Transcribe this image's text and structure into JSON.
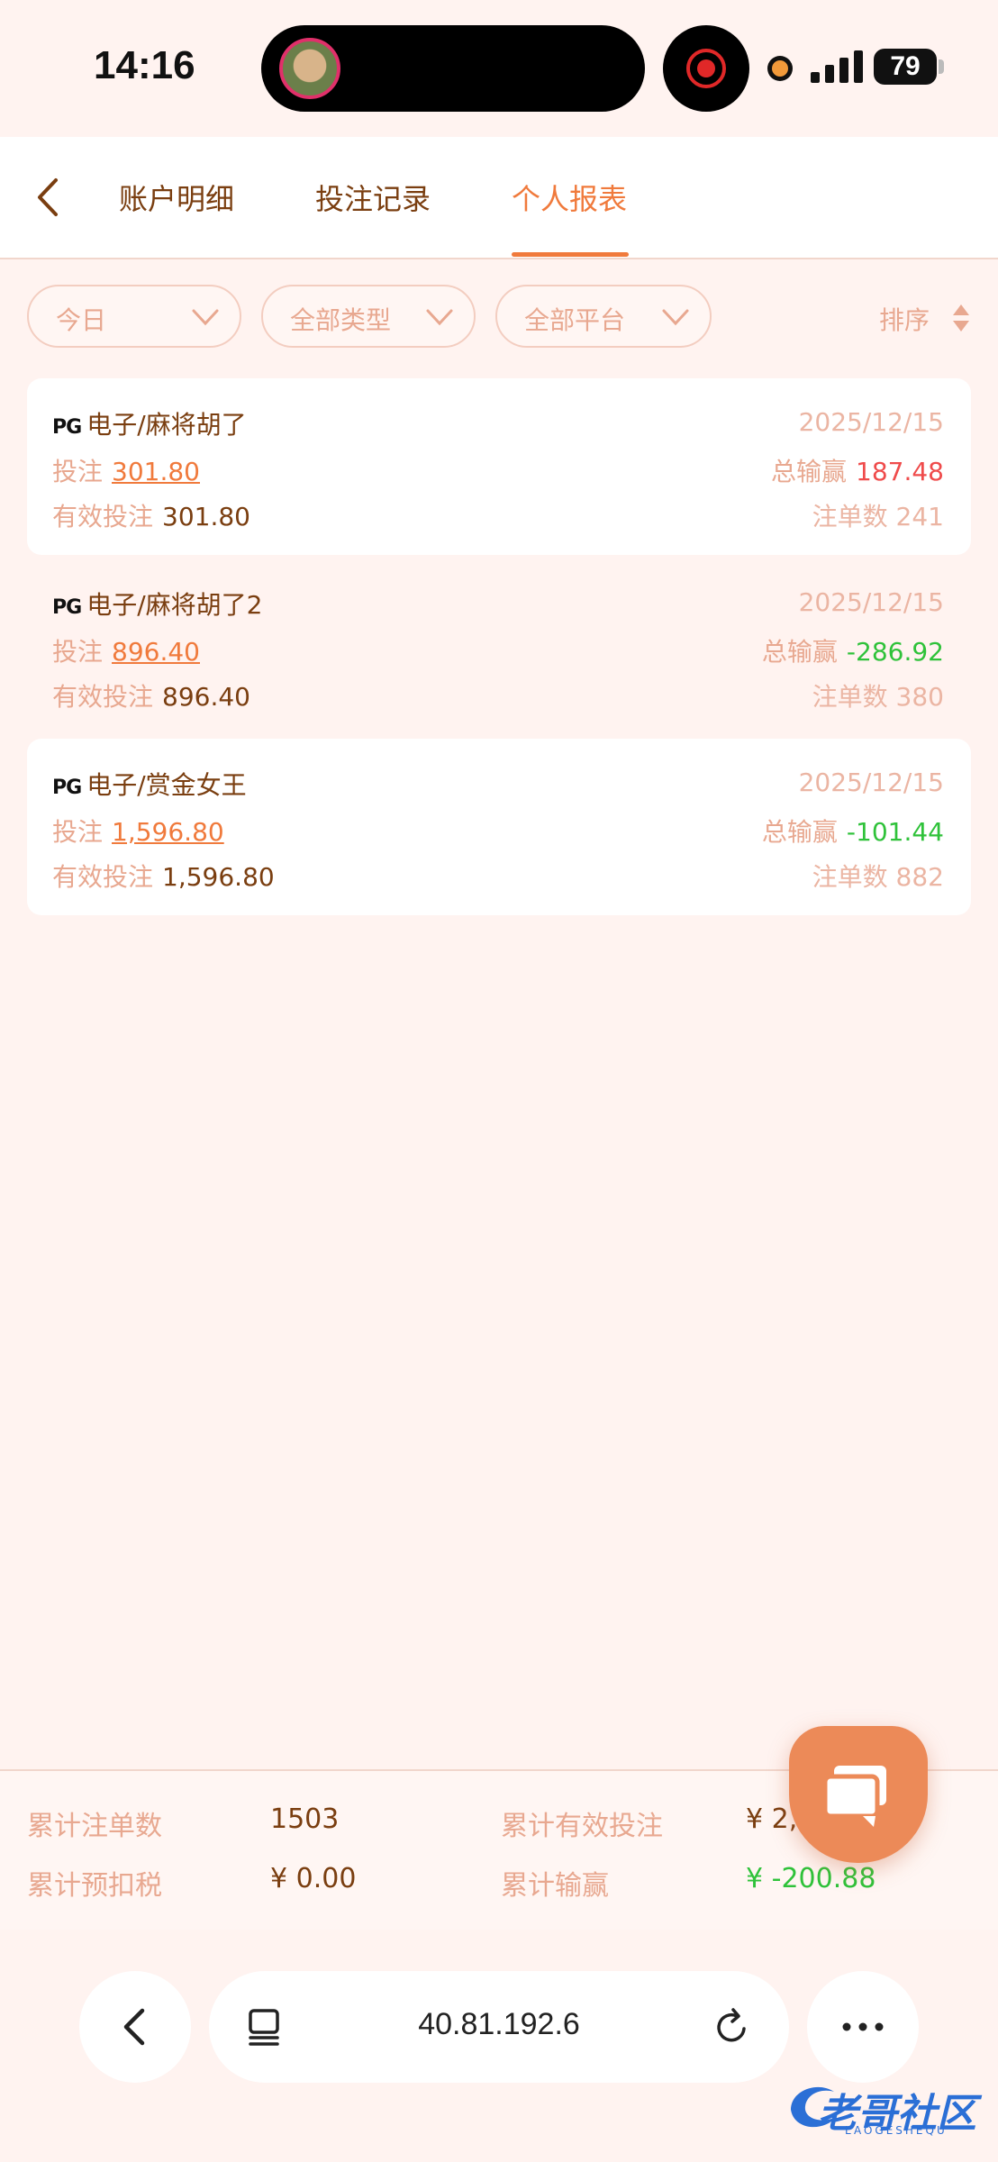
{
  "status_bar": {
    "time": "14:16",
    "battery": "79"
  },
  "nav": {
    "tabs": [
      {
        "label": "账户明细",
        "active": false
      },
      {
        "label": "投注记录",
        "active": false
      },
      {
        "label": "个人报表",
        "active": true
      }
    ]
  },
  "filters": {
    "date": "今日",
    "type": "全部类型",
    "platform": "全部平台",
    "sort": "排序"
  },
  "records": [
    {
      "brand": "PG",
      "title": "电子/麻将胡了",
      "date": "2025/12/15",
      "bet_label": "投注",
      "bet": "301.80",
      "total_label": "总输赢",
      "total": "187.48",
      "total_color": "#ef4b4b",
      "valid_label": "有效投注",
      "valid": "301.80",
      "count_label": "注单数",
      "count": "241"
    },
    {
      "brand": "PG",
      "title": "电子/麻将胡了2",
      "date": "2025/12/15",
      "bet_label": "投注",
      "bet": "896.40",
      "total_label": "总输赢",
      "total": "-286.92",
      "total_color": "#2fc23a",
      "valid_label": "有效投注",
      "valid": "896.40",
      "count_label": "注单数",
      "count": "380"
    },
    {
      "brand": "PG",
      "title": "电子/赏金女王",
      "date": "2025/12/15",
      "bet_label": "投注",
      "bet": "1,596.80",
      "total_label": "总输赢",
      "total": "-101.44",
      "total_color": "#2fc23a",
      "valid_label": "有效投注",
      "valid": "1,596.80",
      "count_label": "注单数",
      "count": "882"
    }
  ],
  "summary": {
    "count_label": "累计注单数",
    "count": "1503",
    "valid_label": "累计有效投注",
    "valid": "¥ 2,",
    "tax_label": "累计预扣税",
    "tax": "¥ 0.00",
    "winloss_label": "累计输赢",
    "winloss": "¥ -200.88"
  },
  "browser": {
    "url": "40.81.192.6"
  },
  "watermark": {
    "text": "老哥社区",
    "sub": "LAOGESHEQU"
  },
  "colors": {
    "accent": "#f07a3c",
    "win": "#ef4b4b",
    "loss": "#2fc23a",
    "background": "#fff3f0"
  }
}
